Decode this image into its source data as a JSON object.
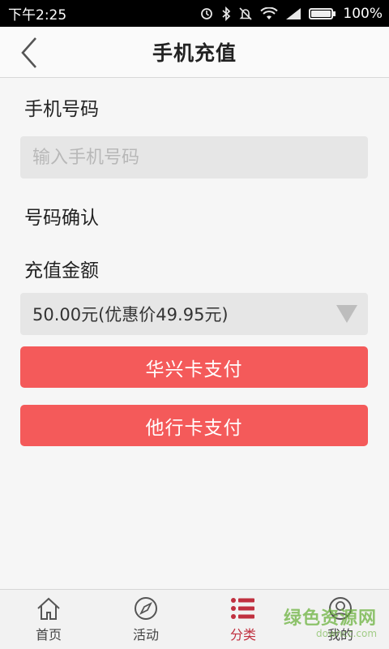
{
  "status_bar": {
    "time": "下午2:25",
    "battery": "100%"
  },
  "header": {
    "title": "手机充值"
  },
  "form": {
    "phone_label": "手机号码",
    "phone_placeholder": "输入手机号码",
    "phone_value": "",
    "confirm_label": "号码确认",
    "amount_label": "充值金额",
    "amount_selected": "50.00元(优惠价49.95元)"
  },
  "buttons": {
    "huaxing": "华兴卡支付",
    "other": "他行卡支付"
  },
  "tabs": [
    {
      "label": "首页",
      "icon": "home-icon"
    },
    {
      "label": "活动",
      "icon": "compass-icon"
    },
    {
      "label": "分类",
      "icon": "list-icon",
      "active": true
    },
    {
      "label": "我的",
      "icon": "user-icon"
    }
  ],
  "watermark": {
    "text": "绿色资源网",
    "sub": "downcc.com"
  },
  "colors": {
    "accent": "#f45a5a",
    "tab_active": "#c0303f",
    "watermark": "#6cb33f"
  }
}
